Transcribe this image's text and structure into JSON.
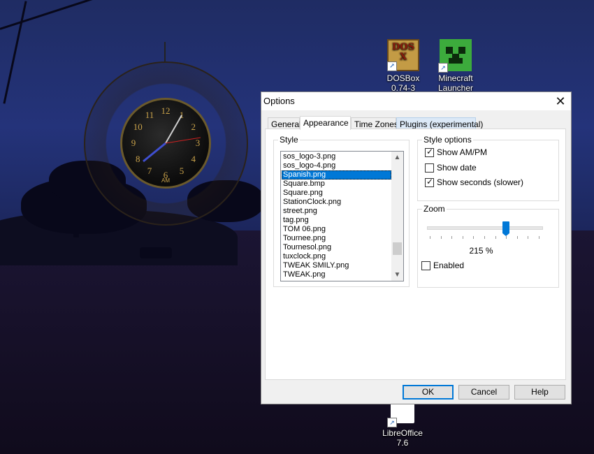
{
  "desktop": {
    "icons": [
      {
        "label_line1": "DOSBox",
        "label_line2": "0.74-3",
        "art": "DOS X"
      },
      {
        "label_line1": "Minecraft",
        "label_line2": "Launcher"
      },
      {
        "label_line1": "LibreOffice",
        "label_line2": "7.6"
      }
    ],
    "clock": {
      "numerals": [
        "12",
        "1",
        "2",
        "3",
        "4",
        "5",
        "6",
        "7",
        "8",
        "9",
        "10",
        "11"
      ],
      "brand": "AM"
    }
  },
  "dialog": {
    "title": "Options",
    "close_glyph": "✕",
    "tabs": [
      "General",
      "Appearance",
      "Time Zones",
      "Plugins (experimental)"
    ],
    "active_tab": "Appearance",
    "style_group": {
      "label": "Style",
      "items": [
        "sos_logo-3.png",
        "sos_logo-4.png",
        "Spanish.png",
        "Square.bmp",
        "Square.png",
        "StationClock.png",
        "street.png",
        "tag.png",
        "TOM 06.png",
        "Tournee.png",
        "Tournesol.png",
        "tuxclock.png",
        "TWEAK SMILY.png",
        "TWEAK.png"
      ],
      "selected": "Spanish.png",
      "scroll_up": "▲",
      "scroll_down": "▼",
      "scroll_position": 0.85
    },
    "style_options": {
      "label": "Style options",
      "show_ampm": {
        "label": "Show AM/PM",
        "checked": true
      },
      "show_date": {
        "label": "Show date",
        "checked": false
      },
      "show_seconds": {
        "label": "Show seconds (slower)",
        "checked": true
      }
    },
    "zoom": {
      "label": "Zoom",
      "value_text": "215 %",
      "slider_fraction": 0.69,
      "enabled": {
        "label": "Enabled",
        "checked": false
      }
    },
    "buttons": {
      "ok": "OK",
      "cancel": "Cancel",
      "help": "Help"
    },
    "check_glyph": "✓"
  }
}
